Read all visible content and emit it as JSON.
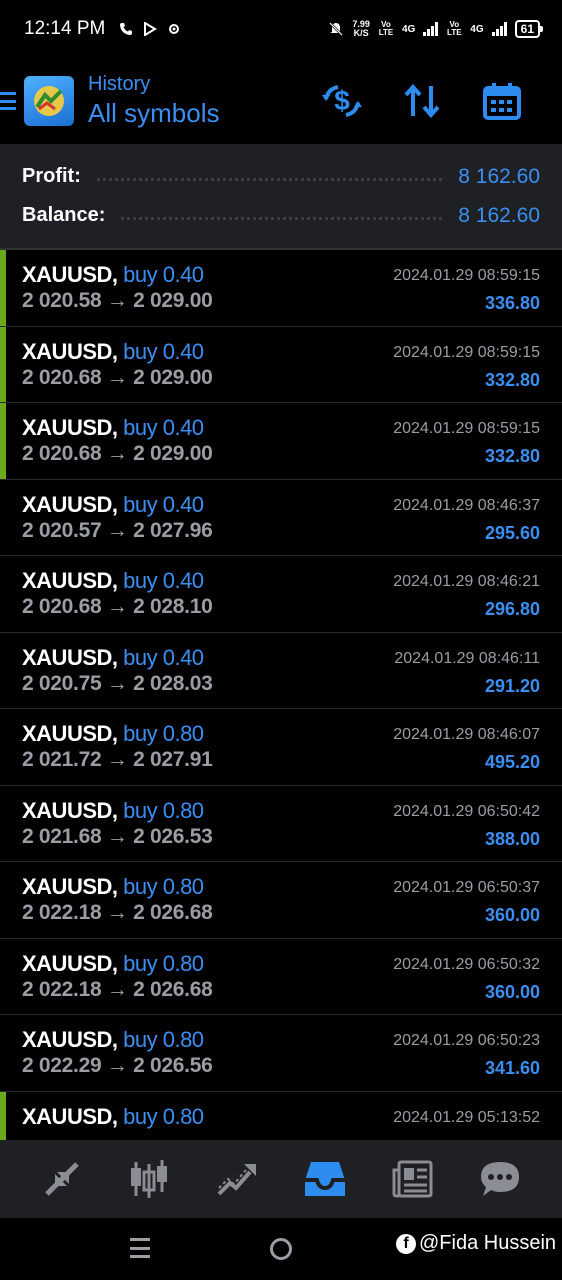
{
  "status_bar": {
    "time": "12:14 PM",
    "net_speed_value": "7.99",
    "net_speed_unit": "K/S",
    "sim1_tag": "Vo LTE",
    "sim1_network": "4G",
    "sim2_tag": "Vo LTE",
    "sim2_network": "4G",
    "battery": "61"
  },
  "header": {
    "subtitle": "History",
    "title": "All symbols",
    "actions": [
      "currency-exchange-icon",
      "sort-icon",
      "calendar-icon"
    ]
  },
  "summary": {
    "profit_label": "Profit:",
    "profit_value": "8 162.60",
    "balance_label": "Balance:",
    "balance_value": "8 162.60"
  },
  "trades": [
    {
      "symbol": "XAUUSD,",
      "side": "buy 0.40",
      "prices": "2 020.58 → 2 029.00",
      "time": "2024.01.29 08:59:15",
      "profit": "336.80",
      "marked": true
    },
    {
      "symbol": "XAUUSD,",
      "side": "buy 0.40",
      "prices": "2 020.68 → 2 029.00",
      "time": "2024.01.29 08:59:15",
      "profit": "332.80",
      "marked": true
    },
    {
      "symbol": "XAUUSD,",
      "side": "buy 0.40",
      "prices": "2 020.68 → 2 029.00",
      "time": "2024.01.29 08:59:15",
      "profit": "332.80",
      "marked": true
    },
    {
      "symbol": "XAUUSD,",
      "side": "buy 0.40",
      "prices": "2 020.57 → 2 027.96",
      "time": "2024.01.29 08:46:37",
      "profit": "295.60",
      "marked": false
    },
    {
      "symbol": "XAUUSD,",
      "side": "buy 0.40",
      "prices": "2 020.68 → 2 028.10",
      "time": "2024.01.29 08:46:21",
      "profit": "296.80",
      "marked": false
    },
    {
      "symbol": "XAUUSD,",
      "side": "buy 0.40",
      "prices": "2 020.75 → 2 028.03",
      "time": "2024.01.29 08:46:11",
      "profit": "291.20",
      "marked": false
    },
    {
      "symbol": "XAUUSD,",
      "side": "buy 0.80",
      "prices": "2 021.72 → 2 027.91",
      "time": "2024.01.29 08:46:07",
      "profit": "495.20",
      "marked": false
    },
    {
      "symbol": "XAUUSD,",
      "side": "buy 0.80",
      "prices": "2 021.68 → 2 026.53",
      "time": "2024.01.29 06:50:42",
      "profit": "388.00",
      "marked": false
    },
    {
      "symbol": "XAUUSD,",
      "side": "buy 0.80",
      "prices": "2 022.18 → 2 026.68",
      "time": "2024.01.29 06:50:37",
      "profit": "360.00",
      "marked": false
    },
    {
      "symbol": "XAUUSD,",
      "side": "buy 0.80",
      "prices": "2 022.18 → 2 026.68",
      "time": "2024.01.29 06:50:32",
      "profit": "360.00",
      "marked": false
    },
    {
      "symbol": "XAUUSD,",
      "side": "buy 0.80",
      "prices": "2 022.29 → 2 026.56",
      "time": "2024.01.29 06:50:23",
      "profit": "341.60",
      "marked": false
    },
    {
      "symbol": "XAUUSD,",
      "side": "buy 0.80",
      "prices": "",
      "time": "2024.01.29 05:13:52",
      "profit": "",
      "marked": true
    }
  ],
  "tabbar": [
    "quotes-icon",
    "chart-icon",
    "trade-icon",
    "history-icon",
    "news-icon",
    "chat-icon"
  ],
  "active_tab": "history-icon",
  "watermark": "@Fida Hussein",
  "colors": {
    "accent": "#3b8ff2",
    "mark": "#6aa81c",
    "panel": "#1e2024"
  }
}
